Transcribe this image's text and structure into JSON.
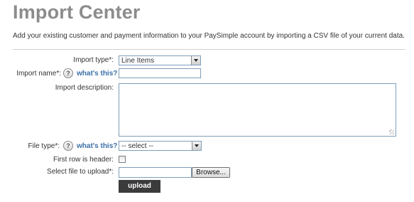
{
  "page": {
    "title": "Import Center",
    "description": "Add your existing customer and payment information to your PaySimple account by importing a CSV file of your current data."
  },
  "form": {
    "import_type": {
      "label": "Import type*:",
      "value": "Line Items"
    },
    "import_name": {
      "label": "Import name*:",
      "help_icon": "?",
      "help_link": "what's this?",
      "value": ""
    },
    "import_description": {
      "label": "Import description:",
      "value": ""
    },
    "file_type": {
      "label": "File type*:",
      "help_icon": "?",
      "help_link": "what's this?",
      "value": "-- select --"
    },
    "first_row_header": {
      "label": "First row is header:",
      "checked": false
    },
    "file_upload": {
      "label": "Select file to upload*:",
      "value": "",
      "browse_label": "Browse..."
    },
    "upload_label": "upload"
  },
  "colors": {
    "title": "#8c8c8c",
    "link": "#3b6fa8",
    "button_bg": "#3b3b3b",
    "input_border": "#7f9db9"
  }
}
